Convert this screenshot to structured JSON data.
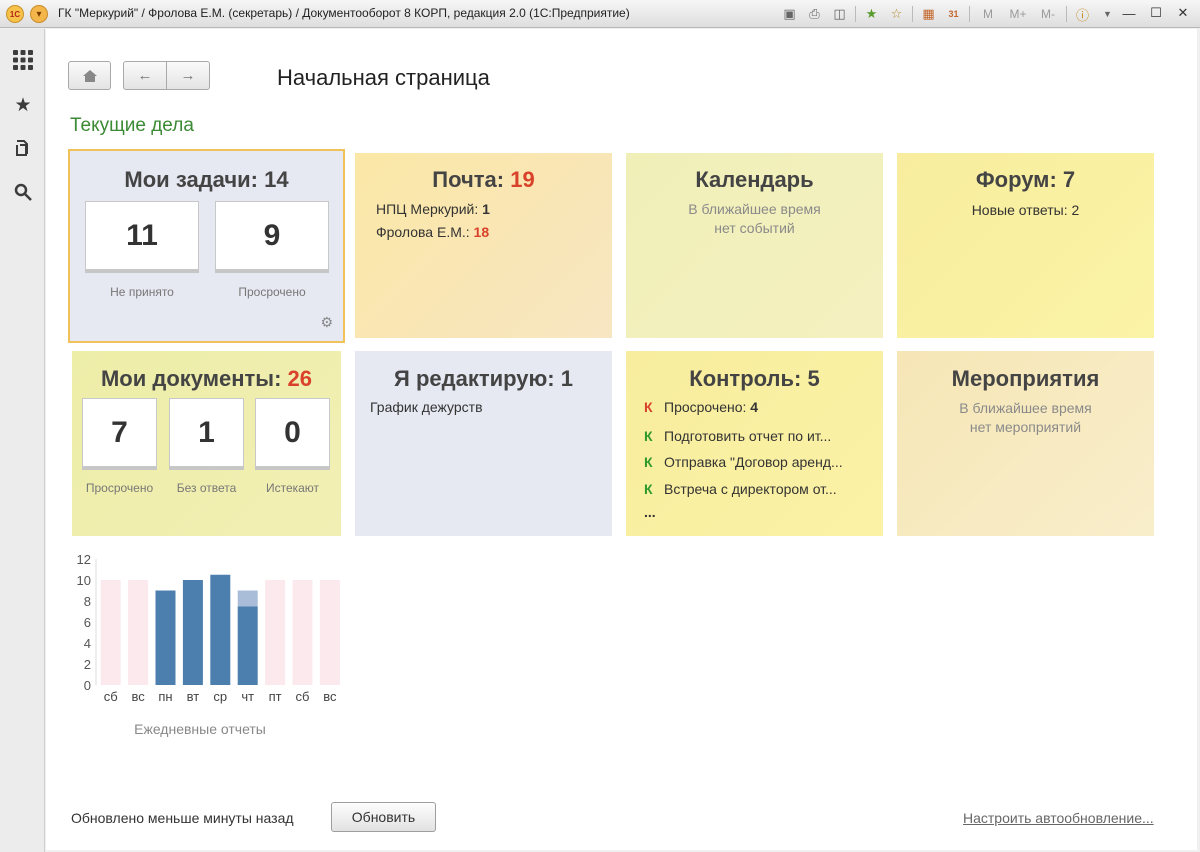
{
  "titlebar": {
    "logo_text": "1С",
    "title": "ГК \"Меркурий\" / Фролова Е.М. (секретарь) / Документооборот 8 КОРП, редакция 2.0  (1С:Предприятие)",
    "m_labels": [
      "M",
      "M+",
      "M-"
    ],
    "calendar_day": "31"
  },
  "header": {
    "page_title": "Начальная страница",
    "section_title": "Текущие дела"
  },
  "tiles": {
    "tasks": {
      "title": "Мои задачи: ",
      "count": "14",
      "counters": [
        {
          "value": "11",
          "label": "Не принято"
        },
        {
          "value": "9",
          "label": "Просрочено"
        }
      ]
    },
    "mail": {
      "title": "Почта: ",
      "count": "19",
      "lines": [
        {
          "name": "НПЦ Меркурий: ",
          "value": "1"
        },
        {
          "name": "Фролова Е.М.: ",
          "value": "18"
        }
      ]
    },
    "calendar": {
      "title": "Календарь",
      "empty_line1": "В ближайшее время",
      "empty_line2": "нет событий"
    },
    "forum": {
      "title": "Форум: 7",
      "line": "Новые ответы: 2"
    },
    "documents": {
      "title": "Мои документы: ",
      "count": "26",
      "counters": [
        {
          "value": "7",
          "label": "Просрочено"
        },
        {
          "value": "1",
          "label": "Без ответа"
        },
        {
          "value": "0",
          "label": "Истекают"
        }
      ]
    },
    "editing": {
      "title": "Я редактирую: 1",
      "line": "График дежурств"
    },
    "control": {
      "title": "Контроль: 5",
      "mark": "К",
      "items": [
        {
          "text": "Просрочено: ",
          "value": "4"
        },
        {
          "text": "Подготовить отчет по ит..."
        },
        {
          "text": "Отправка \"Договор аренд..."
        },
        {
          "text": "Встреча с директором от..."
        }
      ],
      "more": "..."
    },
    "events": {
      "title": "Мероприятия",
      "empty_line1": "В ближайшее время",
      "empty_line2": "нет мероприятий"
    }
  },
  "chart_data": {
    "type": "bar",
    "title": "Ежедневные отчеты",
    "categories": [
      "сб",
      "вс",
      "пн",
      "вт",
      "ср",
      "чт",
      "пт",
      "сб",
      "вс"
    ],
    "series": [
      {
        "values": [
          0,
          0,
          9,
          10,
          10.5,
          7.5,
          0,
          0,
          0
        ]
      },
      {
        "values": [
          0,
          0,
          0,
          0,
          0,
          1.5,
          0,
          0,
          0
        ]
      }
    ],
    "background_values": [
      10,
      10,
      0,
      0,
      0,
      0,
      10,
      10,
      10
    ],
    "yticks": [
      0,
      2,
      4,
      6,
      8,
      10,
      12
    ],
    "ylim": [
      0,
      12
    ],
    "colors": {
      "main": "#4d7fae",
      "light": "#a9bcd8",
      "background": "#fbe9ee"
    }
  },
  "footer": {
    "status": "Обновлено меньше минуты назад",
    "refresh_label": "Обновить",
    "autorefresh_label": "Настроить автообновление..."
  }
}
